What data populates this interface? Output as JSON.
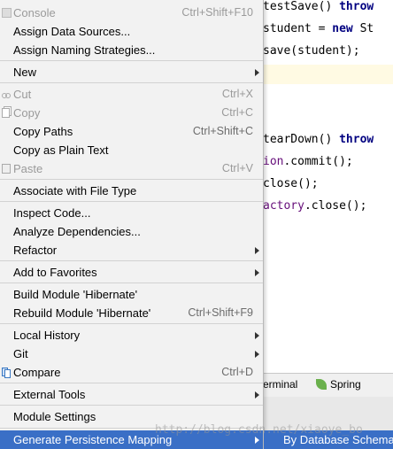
{
  "editor": {
    "lines": [
      {
        "id": "l1",
        "parts": [
          {
            "t": "testSave() ",
            "c": ""
          },
          {
            "t": "throw",
            "c": "kw"
          }
        ]
      },
      {
        "id": "l2",
        "parts": [
          {
            "t": "student = ",
            "c": ""
          },
          {
            "t": "new",
            "c": "kw"
          },
          {
            "t": " St",
            "c": ""
          }
        ]
      },
      {
        "id": "l3",
        "parts": [
          {
            "t": "save(student);",
            "c": ""
          }
        ]
      },
      {
        "id": "l4",
        "parts": [
          {
            "t": "tearDown() ",
            "c": ""
          },
          {
            "t": "throw",
            "c": "kw"
          }
        ]
      },
      {
        "id": "l5",
        "parts": [
          {
            "t": "ion",
            "c": "fld"
          },
          {
            "t": ".commit();",
            "c": ""
          }
        ]
      },
      {
        "id": "l6",
        "parts": [
          {
            "t": "close();",
            "c": ""
          }
        ]
      },
      {
        "id": "l7",
        "parts": [
          {
            "t": "actory",
            "c": "fld"
          },
          {
            "t": ".close();",
            "c": ""
          }
        ]
      }
    ]
  },
  "toolstrip": {
    "terminal": "erminal",
    "spring": "Spring"
  },
  "watermark": "http://blog.csdn.net/xiaoye_bo",
  "menu": {
    "items": [
      {
        "label": "Console",
        "shortcut": "Ctrl+Shift+F10",
        "disabled": true,
        "icon": "console-icon"
      },
      {
        "label": "Assign Data Sources...",
        "shortcut": ""
      },
      {
        "label": "Assign Naming Strategies...",
        "shortcut": ""
      },
      {
        "label": "New",
        "shortcut": "",
        "submenu": true
      },
      {
        "label": "Cut",
        "shortcut": "Ctrl+X",
        "disabled": true,
        "icon": "scissors-icon"
      },
      {
        "label": "Copy",
        "shortcut": "Ctrl+C",
        "disabled": true,
        "icon": "copy-icon"
      },
      {
        "label": "Copy Paths",
        "shortcut": "Ctrl+Shift+C"
      },
      {
        "label": "Copy as Plain Text",
        "shortcut": ""
      },
      {
        "label": "Paste",
        "shortcut": "Ctrl+V",
        "disabled": true,
        "icon": "paste-icon"
      },
      {
        "label": "Associate with File Type",
        "shortcut": ""
      },
      {
        "label": "Inspect Code...",
        "shortcut": ""
      },
      {
        "label": "Analyze Dependencies...",
        "shortcut": ""
      },
      {
        "label": "Refactor",
        "shortcut": "",
        "submenu": true
      },
      {
        "label": "Add to Favorites",
        "shortcut": "",
        "submenu": true
      },
      {
        "label": "Build Module 'Hibernate'",
        "shortcut": ""
      },
      {
        "label": "Rebuild Module 'Hibernate'",
        "shortcut": "Ctrl+Shift+F9"
      },
      {
        "label": "Local History",
        "shortcut": "",
        "submenu": true
      },
      {
        "label": "Git",
        "shortcut": "",
        "submenu": true
      },
      {
        "label": "Compare",
        "shortcut": "Ctrl+D",
        "icon": "compare-icon"
      },
      {
        "label": "External Tools",
        "shortcut": "",
        "submenu": true
      },
      {
        "label": "Module Settings",
        "shortcut": ""
      },
      {
        "label": "Generate Persistence Mapping",
        "shortcut": "",
        "submenu": true,
        "active": true
      }
    ]
  },
  "submenu": {
    "items": [
      {
        "label": "By Database Schema"
      }
    ]
  },
  "colors": {
    "menu_bg": "#f2f2f2",
    "highlight": "#3a6fc6",
    "disabled_text": "#9a9a9a"
  }
}
